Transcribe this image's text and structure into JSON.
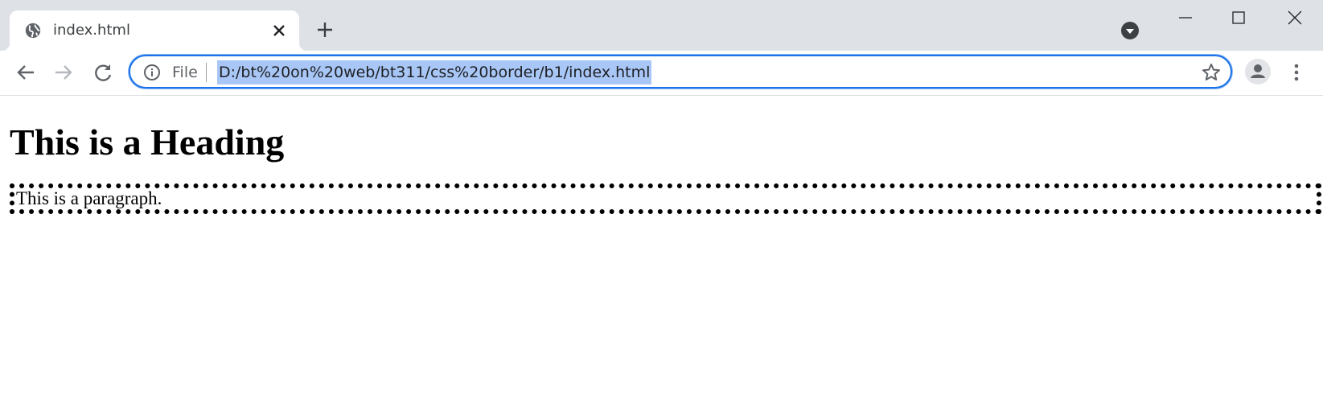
{
  "tab": {
    "title": "index.html",
    "favicon": "globe-icon"
  },
  "window_controls": [
    "minimize-icon",
    "maximize-icon",
    "close-icon"
  ],
  "toolbar": {
    "back": "arrow-left-icon",
    "forward": "arrow-right-icon",
    "reload": "reload-icon",
    "site_label": "File",
    "url": "D:/bt%20on%20web/bt311/css%20border/b1/index.html",
    "bookmark": "star-icon",
    "profile": "person-icon",
    "menu": "more-vert-icon"
  },
  "page": {
    "heading": "This is a Heading",
    "paragraph": "This is a paragraph."
  },
  "colors": {
    "accent": "#1a73e8",
    "selection": "#a8c7f7",
    "tabstrip": "#dee1e6"
  }
}
